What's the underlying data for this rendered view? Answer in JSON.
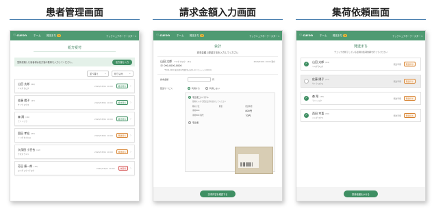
{
  "headings": [
    "患者管理画面",
    "請求金額入力画面",
    "集荷依頼画面"
  ],
  "app": {
    "logo": "curon",
    "nav_home": "ホーム",
    "nav_ship": "発送まち",
    "nav_ship_badge": "3",
    "user_menu": "テックシュアホーテースター ▾"
  },
  "screen1": {
    "title": "処方受付",
    "notice_text": "登録依頼した患者様は処方箋の数量を入力してください。",
    "notice_button": "処方箋を入力",
    "sort_labels": [
      "並べ替え",
      "絞り込み"
    ],
    "patients": [
      {
        "name": "山田 太郎",
        "age": "(64)",
        "kana": "ヤマダ タロウ",
        "date": "2020/03/01 10:00",
        "tag": "処方待ち",
        "tag_color": "green"
      },
      {
        "name": "佐藤 陽子",
        "age": "(47)",
        "kana": "サトウ ヨウコ",
        "date": "2020/03/01 10:00",
        "tag": "処方待ち",
        "tag_color": "green"
      },
      {
        "name": "森 翔",
        "age": "(26)",
        "kana": "モリ ショウ",
        "date": "2020/03/01 10:00",
        "tag": "処方待ち",
        "tag_color": "green"
      },
      {
        "name": "園田 孝宏",
        "age": "(62)",
        "kana": "ソノダ タカヒロ",
        "date": "2020/03/01 10:00",
        "tag": "発送待ち",
        "tag_color": "orange"
      },
      {
        "name": "久保田 小百合",
        "age": "(42)",
        "kana": "クボタ サユリ",
        "date": "2020/03/01 10:00",
        "tag": "発送待ち",
        "tag_color": "orange"
      },
      {
        "name": "芳田 康一郎",
        "age": "(70)",
        "kana": "ヨシダ コウイチロウ",
        "date": "2020/03/01 10:00",
        "tag": "未受付",
        "tag_color": "red"
      }
    ]
  },
  "screen2": {
    "title": "会計",
    "instruction": "請求金額と配送方法を入力してください",
    "patient_name": "山田 太郎",
    "patient_kana": "ヤマダ タロウ",
    "patient_age": "(64)",
    "date": "2020/03/01 10:00 受付",
    "phone": "090-0000-0000",
    "address": "〒000-0000 東京都千代田区丸の内0-0-0 マンション0000号",
    "amount_label": "請求金額",
    "amount_unit": "円",
    "delivery_label": "配送サービス",
    "delivery_on": "利用する",
    "delivery_off": "利用しない",
    "option1": "宅急便コンパクト",
    "option1_desc": "薬剤を入れて配送伝票を貼付してください",
    "grid": [
      "箱の寸法",
      "重量",
      "配送料金",
      "専用BOX",
      "",
      "800円",
      "専用BOX 箱代",
      "",
      "70円"
    ],
    "option2": "宅急便",
    "footer_button": "請求内容を確認する"
  },
  "screen3": {
    "title": "発送まち",
    "subtitle": "チェックが終了している患者の集荷依頼を行ってください",
    "items": [
      {
        "name": "山田 太郎",
        "age": "(64)",
        "kana": "ヤマダ タロウ",
        "status": "発送準備",
        "tag": "発送待ち",
        "checked": true
      },
      {
        "name": "佐藤 陽子",
        "age": "(47)",
        "kana": "サトウ ヨウコ",
        "status": "発送準備",
        "tag": "発送待ち",
        "checked": false
      },
      {
        "name": "森 翔",
        "age": "(26)",
        "kana": "モリ ショウ",
        "status": "発送準備",
        "tag": "発送待ち",
        "checked": true
      },
      {
        "name": "西田 幸喜",
        "age": "(50)",
        "kana": "ニシダ コウキ",
        "status": "発送準備",
        "tag": "発送待ち",
        "checked": true
      }
    ],
    "footer_button": "集荷依頼をかける"
  }
}
